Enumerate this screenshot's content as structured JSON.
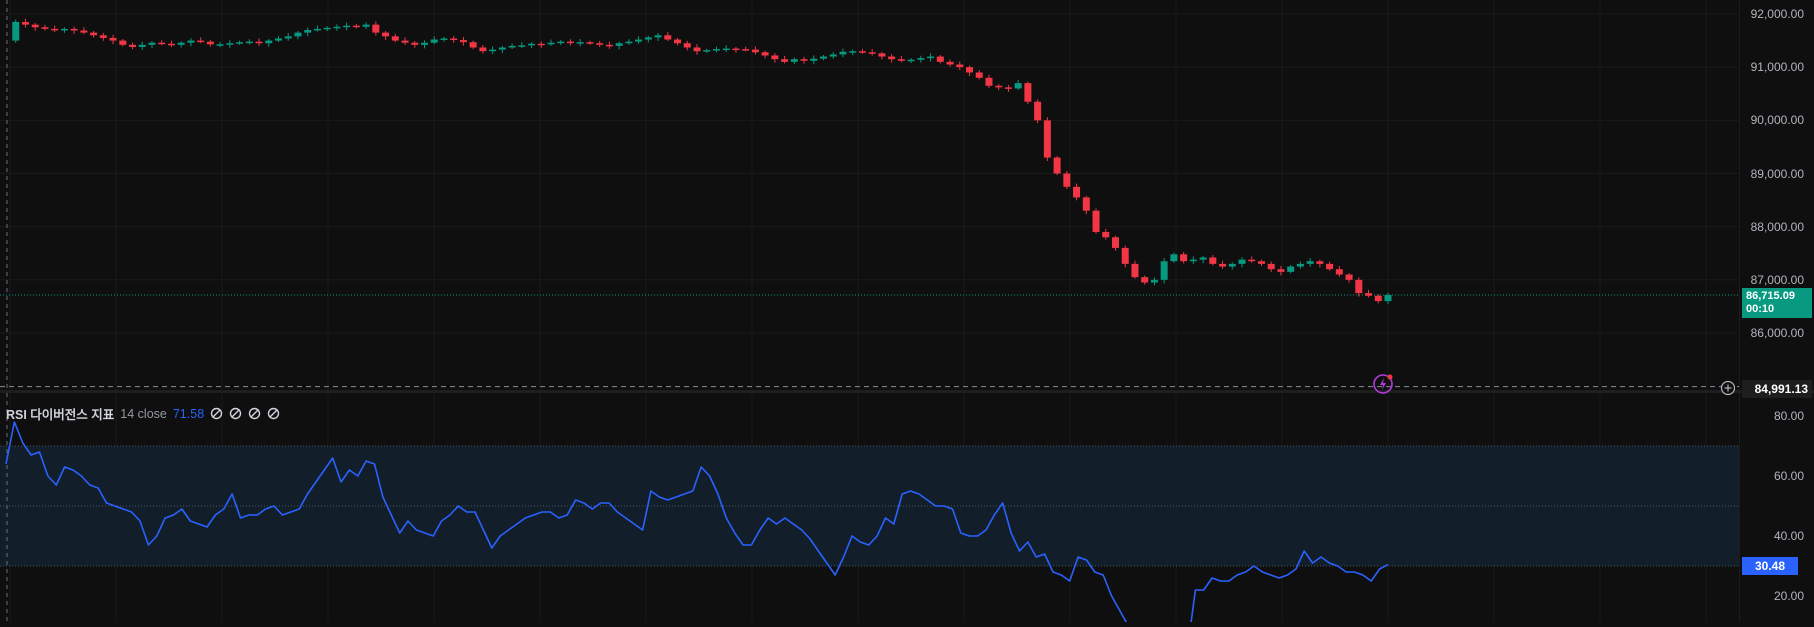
{
  "price_axis": {
    "ticks": [
      "92,000.00",
      "91,000.00",
      "90,000.00",
      "89,000.00",
      "88,000.00",
      "87,000.00",
      "86,000.00"
    ],
    "tick_values": [
      92000,
      91000,
      90000,
      89000,
      88000,
      87000,
      86000
    ],
    "current_price_label": "86,715.09",
    "countdown_label": "00:10",
    "current_price": 86715.09,
    "crosshair_label": "84,991.13",
    "crosshair_value": 84991.13
  },
  "rsi_axis": {
    "ticks": [
      "80.00",
      "60.00",
      "40.00",
      "20.00"
    ],
    "tick_values": [
      80,
      60,
      40,
      20
    ],
    "current_label": "30.48",
    "current_value": 30.48
  },
  "legend": {
    "name": "RSI 다이버전스 지표",
    "params": "14 close",
    "value": "71.58"
  },
  "icons": {
    "hidden_plots": [
      "eye-slash-icon",
      "eye-slash-icon",
      "eye-slash-icon",
      "eye-slash-icon"
    ],
    "plus": "plus-circle-icon",
    "alert": "lightning-alert-icon"
  },
  "colors": {
    "up": "#089981",
    "down": "#f23645",
    "rsi_line": "#2962ff",
    "rsi_band": "#131e2b",
    "background": "#0f0f0f"
  },
  "chart_data": {
    "type": "candlestick",
    "y_range": [
      84800,
      92200
    ],
    "rsi_range": [
      15,
      85
    ],
    "rsi_bands": [
      70,
      50,
      30
    ],
    "price_path": [
      91500,
      91850,
      91800,
      91750,
      91720,
      91700,
      91720,
      91690,
      91650,
      91600,
      91550,
      91500,
      91420,
      91380,
      91420,
      91460,
      91440,
      91420,
      91460,
      91500,
      91480,
      91430,
      91430,
      91450,
      91470,
      91480,
      91450,
      91500,
      91540,
      91580,
      91650,
      91700,
      91720,
      91740,
      91760,
      91780,
      91760,
      91800,
      91650,
      91580,
      91500,
      91460,
      91420,
      91460,
      91520,
      91540,
      91510,
      91470,
      91370,
      91300,
      91330,
      91370,
      91400,
      91410,
      91440,
      91430,
      91460,
      91480,
      91460,
      91470,
      91450,
      91420,
      91400,
      91450,
      91480,
      91520,
      91560,
      91600,
      91520,
      91450,
      91370,
      91300,
      91320,
      91340,
      91350,
      91340,
      91330,
      91280,
      91220,
      91150,
      91100,
      91150,
      91120,
      91160,
      91200,
      91240,
      91290,
      91300,
      91280,
      91260,
      91200,
      91150,
      91120,
      91140,
      91170,
      91200,
      91100,
      91050,
      91000,
      90900,
      90800,
      90650,
      90620,
      90600,
      90700,
      90350,
      90000,
      89300,
      89000,
      88750,
      88550,
      88300,
      87900,
      87800,
      87600,
      87300,
      87050,
      86950,
      87000,
      87350,
      87480,
      87350,
      87380,
      87420,
      87300,
      87250,
      87300,
      87380,
      87350,
      87300,
      87200,
      87150,
      87250,
      87300,
      87350,
      87300,
      87200,
      87100,
      87000,
      86750,
      86700,
      86600,
      86715.09
    ],
    "rsi": [
      64,
      78,
      71,
      67,
      68,
      60,
      57,
      63,
      62,
      60,
      57,
      56,
      51,
      50,
      49,
      48,
      45,
      37,
      40,
      46,
      47,
      49,
      45,
      44,
      43,
      47,
      49,
      54,
      46,
      47,
      47,
      49,
      50,
      47,
      48,
      49,
      54,
      58,
      62,
      66,
      58,
      62,
      60,
      65,
      64,
      53,
      47,
      41,
      45,
      42,
      41,
      40,
      45,
      47,
      50,
      48,
      48,
      42,
      36,
      40,
      42,
      44,
      46,
      47,
      48,
      48,
      46,
      47,
      52,
      51,
      49,
      51,
      51,
      48,
      46,
      44,
      42,
      55,
      53,
      52,
      53,
      54,
      55,
      63,
      60,
      54,
      46,
      41,
      37,
      37,
      42,
      46,
      44,
      46,
      44,
      42,
      39,
      35,
      31,
      27,
      33,
      40,
      38,
      37,
      40,
      46,
      44,
      54,
      55,
      54,
      52,
      50,
      50,
      49,
      41,
      40,
      40,
      42,
      47,
      51,
      41,
      35,
      38,
      33,
      34,
      28,
      27,
      25,
      33,
      32,
      28,
      27,
      20,
      15,
      10,
      6,
      3,
      1,
      1,
      1,
      1,
      1,
      22,
      22,
      26,
      25,
      25,
      27,
      28,
      30,
      28,
      27,
      26,
      27,
      29,
      35,
      31,
      33,
      31,
      30,
      28,
      28,
      27,
      25,
      29,
      30.48
    ]
  }
}
